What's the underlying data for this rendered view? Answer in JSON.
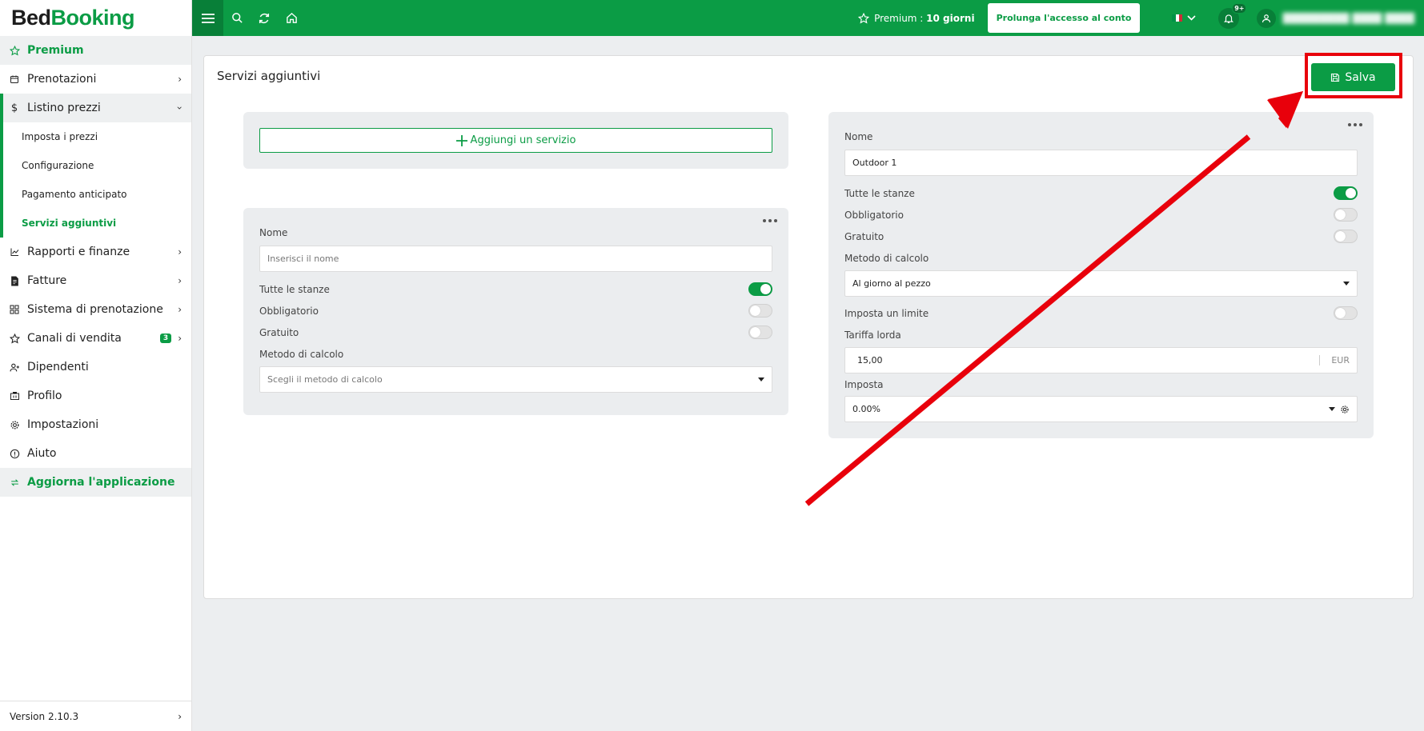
{
  "brand": {
    "part1": "Bed",
    "part2": "Booking"
  },
  "topbar": {
    "premium_label": "Premium : ",
    "premium_days": "10 giorni",
    "extend_button": "Prolunga l'accesso al conto",
    "notifications_badge": "9+",
    "username": "█████████ ████ ████"
  },
  "sidebar": {
    "premium": "Premium",
    "items": {
      "prenotazioni": "Prenotazioni",
      "listino": "Listino prezzi",
      "imposta": "Imposta i prezzi",
      "configurazione": "Configurazione",
      "pagamento": "Pagamento anticipato",
      "servizi": "Servizi aggiuntivi",
      "rapporti": "Rapporti e finanze",
      "fatture": "Fatture",
      "sistema": "Sistema di prenotazione",
      "canali": "Canali di vendita",
      "canali_badge": "3",
      "dipendenti": "Dipendenti",
      "profilo": "Profilo",
      "impostazioni": "Impostazioni",
      "aiuto": "Aiuto"
    },
    "update": "Aggiorna l'applicazione",
    "version": "Version 2.10.3"
  },
  "main": {
    "title": "Servizi aggiuntivi",
    "save_button": "Salva",
    "add_service_button": "Aggiungi un servizio",
    "new_service": {
      "name_label": "Nome",
      "name_placeholder": "Inserisci il nome",
      "all_rooms_label": "Tutte le stanze",
      "all_rooms_on": true,
      "mandatory_label": "Obbligatorio",
      "mandatory_on": false,
      "free_label": "Gratuito",
      "free_on": false,
      "calc_method_label": "Metodo di calcolo",
      "calc_method_placeholder": "Scegli il metodo di calcolo"
    },
    "service1": {
      "name_label": "Nome",
      "name_value": "Outdoor 1",
      "all_rooms_label": "Tutte le stanze",
      "all_rooms_on": true,
      "mandatory_label": "Obbligatorio",
      "mandatory_on": false,
      "free_label": "Gratuito",
      "free_on": false,
      "calc_method_label": "Metodo di calcolo",
      "calc_method_value": "Al giorno al pezzo",
      "limit_label": "Imposta un limite",
      "limit_on": false,
      "gross_rate_label": "Tariffa lorda",
      "gross_rate_value": "15,00",
      "currency": "EUR",
      "tax_label": "Imposta",
      "tax_value": "0.00%"
    }
  },
  "colors": {
    "brand_green": "#0b9c45",
    "annotation_red": "#e8000b"
  }
}
